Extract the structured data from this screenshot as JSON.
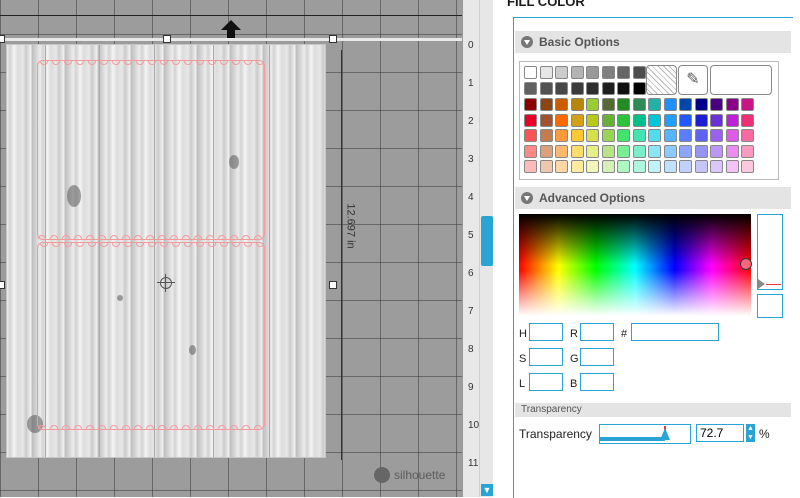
{
  "panel": {
    "title": "FILL COLOR",
    "basic_options": "Basic Options",
    "advanced_options": "Advanced Options",
    "transparency_header": "Transparency",
    "transparency_label": "Transparency",
    "transparency_value": "72.7",
    "transparency_unit": "%",
    "transparency_level": 0.727,
    "fields": {
      "h": "H",
      "s": "S",
      "l": "L",
      "r": "R",
      "g": "G",
      "b": "B",
      "hex": "#"
    }
  },
  "canvas": {
    "dimension_label": "12.697 in",
    "watermark": "silhouette",
    "ruler_numbers": [
      "0",
      "1",
      "2",
      "3",
      "4",
      "5",
      "6",
      "7",
      "8",
      "9",
      "10",
      "11"
    ]
  },
  "swatches": {
    "grays": [
      "#ffffff",
      "#e6e6e6",
      "#cccccc",
      "#b3b3b3",
      "#999999",
      "#808080",
      "#666666",
      "#4d4d4d",
      "#616161",
      "#525252",
      "#474747",
      "#3b3b3b",
      "#2e2e2e",
      "#1f1f1f",
      "#0f0f0f",
      "#000000"
    ],
    "rows": [
      [
        "#8b0000",
        "#8b4513",
        "#cd5c00",
        "#b8860b",
        "#9acd32",
        "#556b2f",
        "#228b22",
        "#2e8b57",
        "#20b2aa",
        "#1e90ff",
        "#0047ab",
        "#00008b",
        "#4b0082",
        "#8b008b",
        "#c71585"
      ],
      [
        "#e8002b",
        "#a0522d",
        "#ff6a00",
        "#d4a017",
        "#b8c91a",
        "#66b032",
        "#2bc43d",
        "#00c08a",
        "#00c6d8",
        "#1fa0ff",
        "#2158ff",
        "#1d1dd4",
        "#6a32d6",
        "#c01fd8",
        "#ea2f77"
      ],
      [
        "#f85656",
        "#c47c4e",
        "#ff9a3c",
        "#ffc933",
        "#d7e04a",
        "#9ad455",
        "#44e36c",
        "#42e5b2",
        "#52dcee",
        "#55b5ff",
        "#5b7dff",
        "#6161f0",
        "#9b60f0",
        "#de5ae6",
        "#f76aa0"
      ],
      [
        "#fb8989",
        "#dba17a",
        "#ffb86b",
        "#ffdd6a",
        "#e6ee86",
        "#b8e486",
        "#79ef95",
        "#7aeec8",
        "#8ae6f4",
        "#8accff",
        "#8ea5ff",
        "#9494f4",
        "#bc96f4",
        "#ea8ced",
        "#fa9ac0"
      ],
      [
        "#fdbcbc",
        "#eec8ad",
        "#ffd6a4",
        "#ffec9e",
        "#f2f6b8",
        "#d5f0b6",
        "#aff7c1",
        "#b0f6df",
        "#bff2f9",
        "#bfe0ff",
        "#c2d0ff",
        "#c5c5fa",
        "#dac6fa",
        "#f4c1f6",
        "#fcc8dd"
      ]
    ]
  },
  "colors": {
    "accent": "#2aa4d4",
    "canvas_bg": "#9c9c9c",
    "cut_line": "#f29a9a"
  }
}
